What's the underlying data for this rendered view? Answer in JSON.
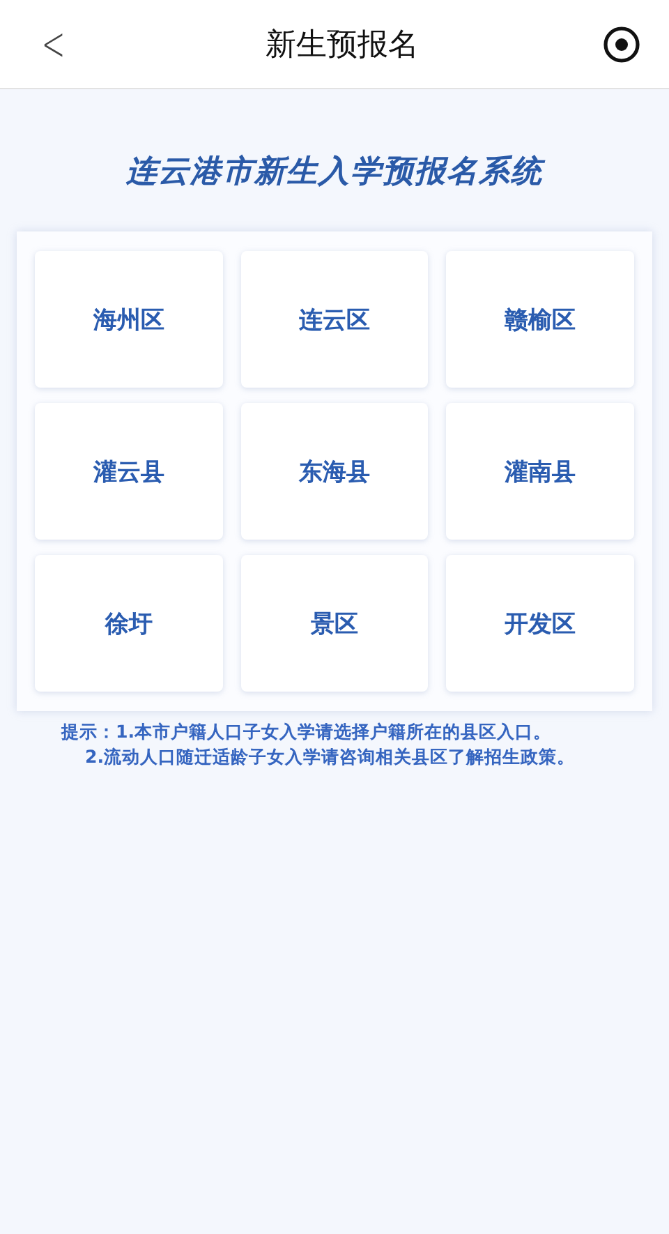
{
  "header": {
    "back_glyph": "<",
    "title": "新生预报名"
  },
  "system_title": "连云港市新生入学预报名系统",
  "districts": [
    "海州区",
    "连云区",
    "赣榆区",
    "灌云县",
    "东海县",
    "灌南县",
    "徐圩",
    "景区",
    "开发区"
  ],
  "hints": [
    "提示：1.本市户籍人口子女入学请选择户籍所在的县区入口。",
    "2.流动人口随迁适龄子女入学请咨询相关县区了解招生政策。"
  ]
}
